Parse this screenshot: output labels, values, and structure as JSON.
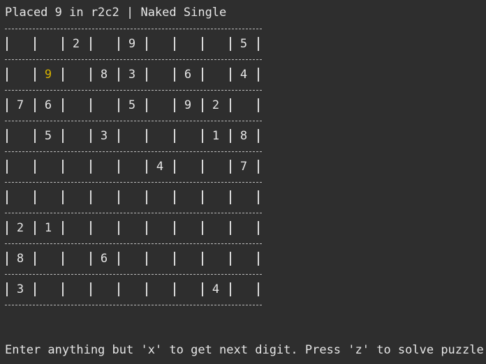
{
  "status": "Placed 9 in r2c2 | Naked Single",
  "board": {
    "highlight_color": "#d6b100",
    "rows": [
      [
        "",
        "",
        "2",
        "",
        "9",
        "",
        "",
        "",
        "5"
      ],
      [
        "",
        "9",
        "",
        "8",
        "3",
        "",
        "6",
        "",
        "4"
      ],
      [
        "7",
        "6",
        "",
        "",
        "5",
        "",
        "9",
        "2",
        ""
      ],
      [
        "",
        "5",
        "",
        "3",
        "",
        "",
        "",
        "1",
        "8"
      ],
      [
        "",
        "",
        "",
        "",
        "",
        "4",
        "",
        "",
        "7"
      ],
      [
        "",
        "",
        "",
        "",
        "",
        "",
        "",
        "",
        ""
      ],
      [
        "2",
        "1",
        "",
        "",
        "",
        "",
        "",
        "",
        ""
      ],
      [
        "8",
        "",
        "",
        "6",
        "",
        "",
        "",
        "",
        ""
      ],
      [
        "3",
        "",
        "",
        "",
        "",
        "",
        "",
        "4",
        ""
      ]
    ],
    "highlight": {
      "row": 1,
      "col": 1
    }
  },
  "prompt": "Enter anything but 'x' to get next digit. Press 'z' to solve puzzle."
}
